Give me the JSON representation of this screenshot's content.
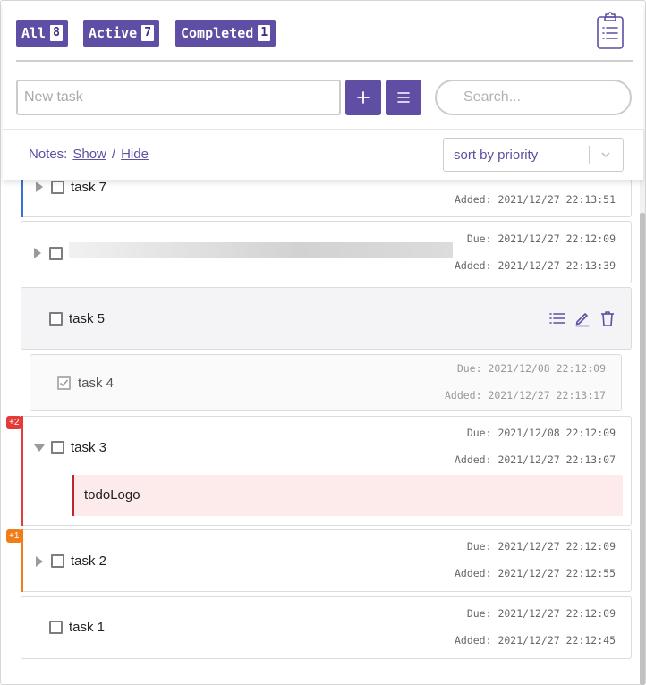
{
  "filters": [
    {
      "label": "All",
      "count": "8"
    },
    {
      "label": "Active",
      "count": "7"
    },
    {
      "label": "Completed",
      "count": "1"
    }
  ],
  "new_task_placeholder": "New task",
  "search_placeholder": "Search...",
  "notes": {
    "label": "Notes:",
    "show": "Show",
    "sep": "/",
    "hide": "Hide"
  },
  "sort": {
    "selected": "sort by priority"
  },
  "accent_color": "#5f4ea3",
  "icons": [
    "clipboard-list-icon",
    "plus-icon",
    "menu-icon",
    "chevron-down-icon",
    "list-icon",
    "edit-icon",
    "trash-icon"
  ],
  "tasks": [
    {
      "name": "task 7",
      "due": "",
      "added": "Added: 2021/12/27 22:13:51",
      "priority_color": "#3a6fd8",
      "expandable": true
    },
    {
      "name": "",
      "redacted": true,
      "due": "Due: 2021/12/27 22:12:09",
      "added": "Added: 2021/12/27 22:13:39",
      "expandable": true
    },
    {
      "name": "task 5",
      "hovered": true,
      "expandable": false
    },
    {
      "name": "task 4",
      "completed": true,
      "due": "Due: 2021/12/08 22:12:09",
      "added": "Added: 2021/12/27 22:13:17"
    },
    {
      "name": "task 3",
      "due": "Due: 2021/12/08 22:12:09",
      "added": "Added: 2021/12/27 22:13:07",
      "priority_color": "#e53a3a",
      "badge": "+2",
      "expanded": true,
      "note": "todoLogo"
    },
    {
      "name": "task 2",
      "due": "Due: 2021/12/27 22:12:09",
      "added": "Added: 2021/12/27 22:12:55",
      "priority_color": "#f07d1a",
      "badge": "+1",
      "expandable": true
    },
    {
      "name": "task 1",
      "due": "Due: 2021/12/27 22:12:09",
      "added": "Added: 2021/12/27 22:12:45",
      "expandable": false
    }
  ]
}
